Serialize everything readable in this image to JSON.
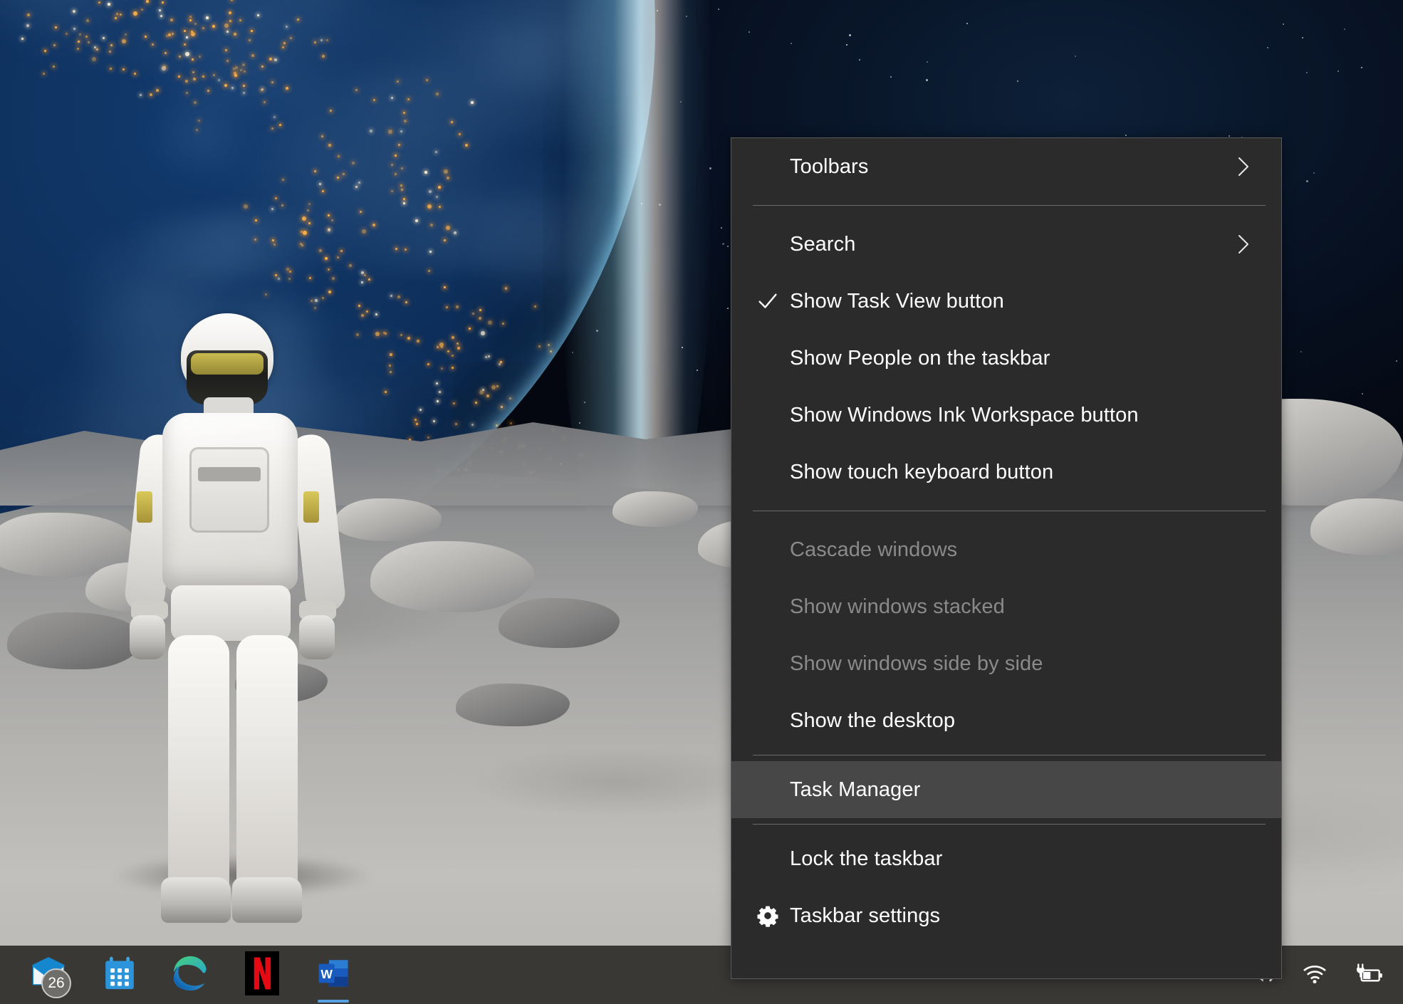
{
  "desktop": {
    "wallpaper_description": "Astronaut standing on lunar surface with Earth rising in the night sky",
    "colors": {
      "menu_background": "#2b2b2b",
      "menu_border": "#5a5a5a",
      "menu_highlight": "#474747",
      "menu_text": "#ffffff",
      "menu_text_disabled": "#8a8a8a",
      "taskbar_background": "#3a3835",
      "taskbar_active_indicator": "#57a0e0"
    }
  },
  "context_menu": {
    "name": "taskbar-context-menu",
    "items": [
      {
        "id": "toolbars",
        "label": "Toolbars",
        "submenu": true,
        "checked": false,
        "disabled": false,
        "highlighted": false,
        "icon": null
      },
      {
        "id": "separator-1",
        "label": "",
        "type": "separator"
      },
      {
        "id": "search",
        "label": "Search",
        "submenu": true,
        "checked": false,
        "disabled": false,
        "highlighted": false,
        "icon": null
      },
      {
        "id": "task-view",
        "label": "Show Task View button",
        "submenu": false,
        "checked": true,
        "disabled": false,
        "highlighted": false,
        "icon": "check-icon"
      },
      {
        "id": "people",
        "label": "Show People on the taskbar",
        "submenu": false,
        "checked": false,
        "disabled": false,
        "highlighted": false,
        "icon": null
      },
      {
        "id": "ink-workspace",
        "label": "Show Windows Ink Workspace button",
        "submenu": false,
        "checked": false,
        "disabled": false,
        "highlighted": false,
        "icon": null
      },
      {
        "id": "touch-keyboard",
        "label": "Show touch keyboard button",
        "submenu": false,
        "checked": false,
        "disabled": false,
        "highlighted": false,
        "icon": null
      },
      {
        "id": "separator-2",
        "label": "",
        "type": "separator"
      },
      {
        "id": "cascade",
        "label": "Cascade windows",
        "submenu": false,
        "checked": false,
        "disabled": true,
        "highlighted": false,
        "icon": null
      },
      {
        "id": "stacked",
        "label": "Show windows stacked",
        "submenu": false,
        "checked": false,
        "disabled": true,
        "highlighted": false,
        "icon": null
      },
      {
        "id": "side-by-side",
        "label": "Show windows side by side",
        "submenu": false,
        "checked": false,
        "disabled": true,
        "highlighted": false,
        "icon": null
      },
      {
        "id": "show-desktop",
        "label": "Show the desktop",
        "submenu": false,
        "checked": false,
        "disabled": false,
        "highlighted": false,
        "icon": null
      },
      {
        "id": "separator-3",
        "label": "",
        "type": "separator"
      },
      {
        "id": "task-manager",
        "label": "Task Manager",
        "submenu": false,
        "checked": false,
        "disabled": false,
        "highlighted": true,
        "icon": null
      },
      {
        "id": "separator-4",
        "label": "",
        "type": "separator"
      },
      {
        "id": "lock-taskbar",
        "label": "Lock the taskbar",
        "submenu": false,
        "checked": false,
        "disabled": false,
        "highlighted": false,
        "icon": null
      },
      {
        "id": "taskbar-settings",
        "label": "Taskbar settings",
        "submenu": false,
        "checked": false,
        "disabled": false,
        "highlighted": false,
        "icon": "gear-icon"
      }
    ]
  },
  "taskbar": {
    "apps": [
      {
        "id": "mail",
        "name": "Mail",
        "icon": "mail-icon",
        "badge": "26",
        "active": false
      },
      {
        "id": "calendar",
        "name": "Calendar",
        "icon": "calendar-icon",
        "badge": null,
        "active": false
      },
      {
        "id": "edge",
        "name": "Microsoft Edge",
        "icon": "edge-icon",
        "badge": null,
        "active": false
      },
      {
        "id": "netflix",
        "name": "Netflix",
        "icon": "netflix-icon",
        "badge": null,
        "active": false
      },
      {
        "id": "word",
        "name": "Word",
        "icon": "word-icon",
        "badge": null,
        "active": true
      }
    ],
    "tray": [
      {
        "id": "volume",
        "name": "Volume",
        "icon": "speaker-icon"
      },
      {
        "id": "network",
        "name": "Network",
        "icon": "wifi-icon"
      },
      {
        "id": "battery",
        "name": "Battery charging",
        "icon": "battery-charging-icon"
      }
    ]
  }
}
